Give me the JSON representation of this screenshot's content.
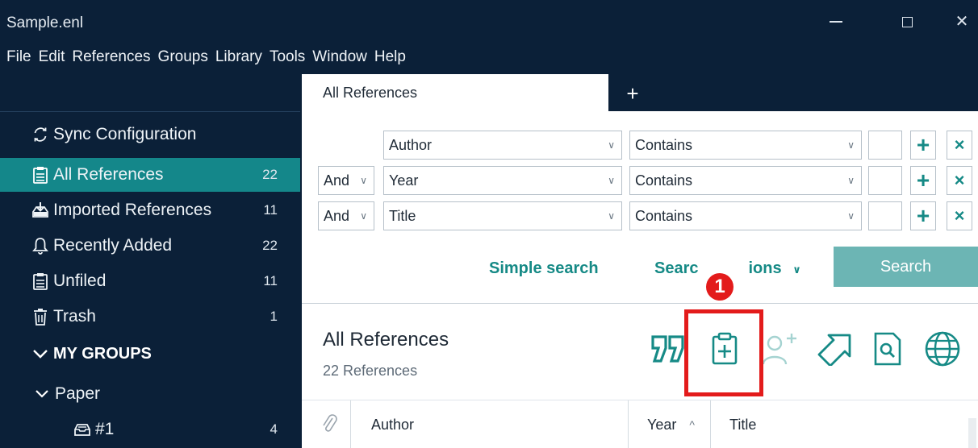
{
  "window": {
    "title": "Sample.enl",
    "controls": {
      "minimize": "—",
      "maximize": "☐",
      "close": "✕"
    }
  },
  "menu": [
    "File",
    "Edit",
    "References",
    "Groups",
    "Library",
    "Tools",
    "Window",
    "Help"
  ],
  "sidebar": {
    "items": [
      {
        "label": "Sync Configuration",
        "count": "",
        "icon": "sync-icon"
      },
      {
        "label": "All References",
        "count": "22",
        "icon": "clipboard-icon",
        "active": true
      },
      {
        "label": "Imported References",
        "count": "11",
        "icon": "import-icon"
      },
      {
        "label": "Recently Added",
        "count": "22",
        "icon": "bell-icon"
      },
      {
        "label": "Unfiled",
        "count": "11",
        "icon": "unfiled-icon"
      },
      {
        "label": "Trash",
        "count": "1",
        "icon": "trash-icon"
      }
    ],
    "group_header": "MY GROUPS",
    "group_set": "Paper",
    "group": {
      "label": "#1",
      "count": "4"
    }
  },
  "tabs": {
    "active": "All References",
    "add": "+"
  },
  "search": {
    "rows": [
      {
        "bool": "",
        "field": "Author",
        "op": "Contains"
      },
      {
        "bool": "And",
        "field": "Year",
        "op": "Contains"
      },
      {
        "bool": "And",
        "field": "Title",
        "op": "Contains"
      }
    ],
    "add_symbol": "+",
    "remove_symbol": "×",
    "simple": "Simple search",
    "options_visible_start": "Searc",
    "options_visible_end": "ions",
    "button": "Search"
  },
  "list": {
    "title": "All References",
    "count": "22 References"
  },
  "annotation": {
    "number": "1",
    "color": "#e31b1b"
  },
  "table": {
    "columns": [
      "Author",
      "Year",
      "Title"
    ],
    "sort_indicator": "^"
  },
  "colors": {
    "accent": "#168a86",
    "sidebar_bg": "#0b2038",
    "active_item": "#14878a",
    "search_button": "#6cb5b4"
  }
}
